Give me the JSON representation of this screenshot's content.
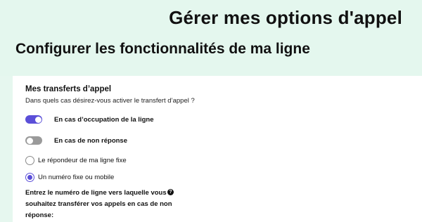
{
  "header": {
    "page_title": "Gérer mes options d'appel",
    "section_title": "Configurer les fonctionnalités de ma ligne"
  },
  "card": {
    "title": "Mes transferts d’appel",
    "subtitle": "Dans quels cas désirez-vous activer le transfert d’appel ?",
    "toggles": [
      {
        "label": "En cas d’occupation de la ligne",
        "state": "on"
      },
      {
        "label": "En cas de non réponse",
        "state": "off"
      }
    ],
    "radios": [
      {
        "label": "Le répondeur de ma ligne fixe",
        "checked": false
      },
      {
        "label": "Un numéro fixe ou mobile",
        "checked": true
      }
    ],
    "question": "Entrez le numéro de ligne vers laquelle vous souhaitez transférer vos appels en cas de non réponse:",
    "help_icon_glyph": "?"
  },
  "colors": {
    "header_background": "#e4f7ee",
    "accent": "#5b4fd8",
    "toggle_off": "#9a9a9a"
  }
}
